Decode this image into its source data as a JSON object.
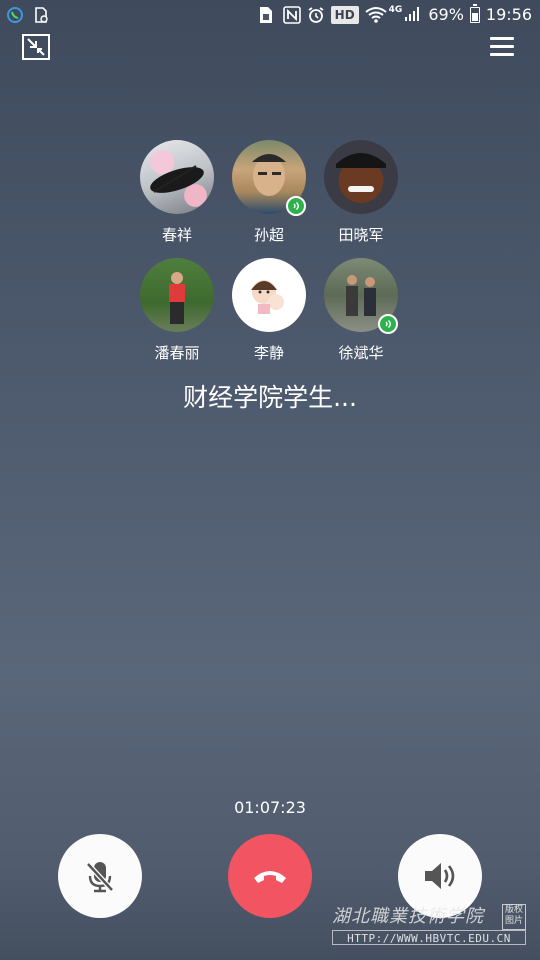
{
  "status_bar": {
    "left_icons": [
      "phone-call-icon",
      "silent-file-icon"
    ],
    "right_icons": [
      "sim-icon",
      "nfc-icon",
      "alarm-icon",
      "hd-icon",
      "wifi-icon",
      "signal-icon",
      "battery-icon"
    ],
    "hd": "HD",
    "network": "4G",
    "battery": "69%",
    "battery_level": 0.69,
    "time": "19:56"
  },
  "participants": [
    {
      "name": "春祥",
      "speaking": false
    },
    {
      "name": "孙超",
      "speaking": true
    },
    {
      "name": "田晓军",
      "speaking": false
    },
    {
      "name": "潘春丽",
      "speaking": false
    },
    {
      "name": "李静",
      "speaking": false
    },
    {
      "name": "徐斌华",
      "speaking": true
    }
  ],
  "group_name": "财经学院学生...",
  "call_timer": "01:07:23",
  "controls": {
    "mute": "microphone-muted-icon",
    "hangup": "hang-up-icon",
    "speaker": "speaker-icon"
  },
  "colors": {
    "hangup": "#f25561",
    "speaking": "#2bb24c"
  },
  "watermark": {
    "title": "湖北職業技術学院",
    "stamp": "版权图片",
    "url": "HTTP://WWW.HBVTC.EDU.CN"
  }
}
